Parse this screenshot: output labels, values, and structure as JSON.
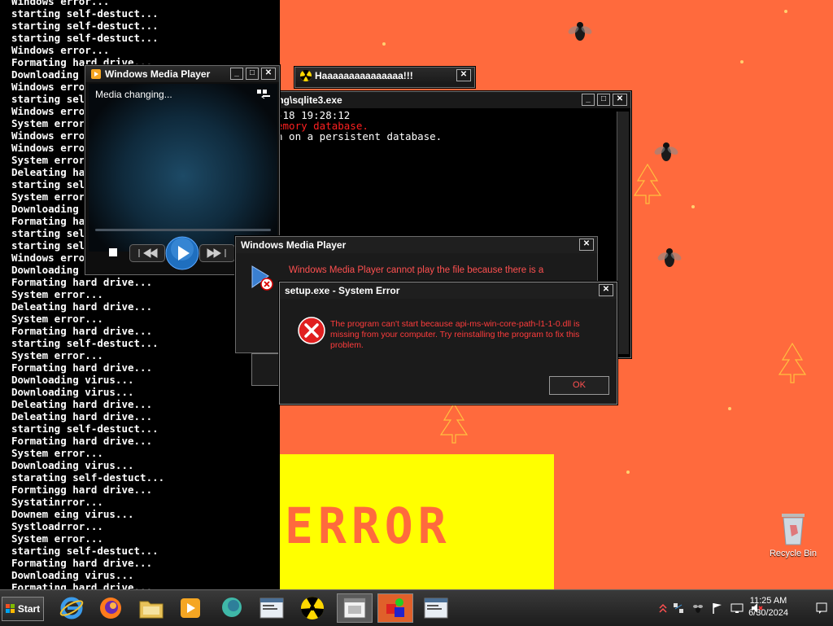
{
  "console": {
    "lines": [
      "Windows error...",
      "starting self-destuct...",
      "starting self-destuct...",
      "starting self-destuct...",
      "Windows error...",
      "Formating hard drive...",
      "Downloading virus...",
      "Windows error...",
      "starting self-destuct...",
      "Windows error...",
      "System error...",
      "Windows error...",
      "Windows error...",
      "System error...",
      "Deleating hard drive...",
      "starting self-destuct...",
      "System error...",
      "Downloading virus...",
      "Formating hard drive...",
      "starting self-destuct...",
      "starting self-destuct...",
      "Windows error...",
      "Downloading virus...",
      "Formating hard drive...",
      "System error...",
      "Deleating hard drive...",
      "System error...",
      "Formating hard drive...",
      "starting self-destuct...",
      "System error...",
      "Formating hard drive...",
      "Downloading virus...",
      "Downloading virus...",
      "Deleating hard drive...",
      "Deleating hard drive...",
      "starting self-destuct...",
      "Formating hard drive...",
      "System error...",
      "Downloading virus...",
      "starating self-destuct...",
      "Formtingg hard drive...",
      "Systatinrror...",
      "Downem eing virus...",
      "Systloadrror...",
      "System error...",
      "starting self-destuct...",
      "Formating hard drive...",
      "Downloading virus...",
      "Formating hard drive..."
    ]
  },
  "wmp": {
    "title": "Windows Media Player",
    "status": "Media changing..."
  },
  "haaa": {
    "title": "Haaaaaaaaaaaaaaa!!!"
  },
  "sqlite": {
    "title": "ing\\sqlite3.exe",
    "line1": "-18 19:28:12",
    "line2": "emory database.",
    "line3": "n on a persistent database."
  },
  "wmp_error": {
    "title": "Windows Media Player",
    "message": "Windows Media Player cannot play the file because there is a"
  },
  "system_error": {
    "title": "setup.exe - System Error",
    "message": "The program can't start because api-ms-win-core-path-l1-1-0.dll is missing from your computer. Try reinstalling the program to fix this problem.",
    "ok_label": "OK"
  },
  "banner": {
    "text": "ERROR"
  },
  "desktop": {
    "recycle_bin": "Recycle Bin"
  },
  "taskbar": {
    "start_label": "Start",
    "time": "11:25 AM",
    "date": "6/30/2024"
  },
  "colors": {
    "desktop_bg": "#ff6a3d",
    "banner_bg": "#ffff00",
    "error_text": "#ff3c3c"
  }
}
